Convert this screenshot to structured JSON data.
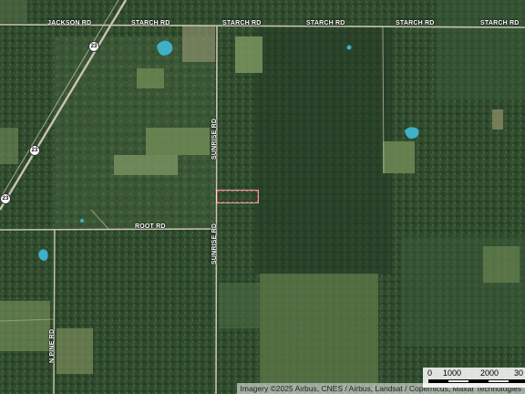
{
  "map": {
    "roads": {
      "jackson": "JACKSON RD",
      "starch_1": "STARCH RD",
      "starch_2": "STARCH RD",
      "starch_3": "STARCH RD",
      "starch_4": "STARCH RD",
      "starch_5": "STARCH RD",
      "root": "ROOT RD",
      "sunrise_north": "SUNRISE RD",
      "sunrise_south": "SUNRISE RD",
      "n_pine": "N PINE RD"
    },
    "highway_shields": [
      "23",
      "23",
      "23"
    ],
    "attribution": "Imagery ©2025 Airbus, CNES / Airbus, Landsat / Copernicus, Maxar Technologies",
    "scale": {
      "labels": [
        "0",
        "1000",
        "2000",
        "30"
      ]
    },
    "colors": {
      "forest": "#2f4b2e",
      "field": "#6f8a55",
      "water": "#3fb0c9",
      "road": "#c9c3b0",
      "parcel_outline": "#ff3b3b"
    }
  }
}
